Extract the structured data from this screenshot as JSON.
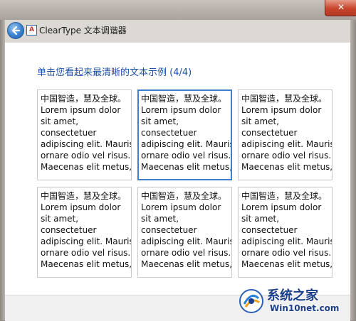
{
  "window": {
    "title": "ClearType 文本调谐器",
    "close_glyph": "✕"
  },
  "page": {
    "heading": "单击您看起来最清晰的文本示例 (4/4)"
  },
  "samples": [
    {
      "lines": [
        "中国智造，慧及全球。",
        "Lorem ipsum dolor",
        "sit amet,",
        "consectetuer",
        "adipiscing elit. Mauris",
        "ornare odio vel risus.",
        "Maecenas elit metus,"
      ],
      "selected": false
    },
    {
      "lines": [
        "中国智造，慧及全球。",
        "Lorem ipsum dolor",
        "sit amet,",
        "consectetuer",
        "adipiscing elit. Mauris",
        "ornare odio vel risus.",
        "Maecenas elit metus,"
      ],
      "selected": true
    },
    {
      "lines": [
        "中国智造，慧及全球。",
        "Lorem ipsum dolor",
        "sit amet,",
        "consectetuer",
        "adipiscing elit. Mauris",
        "ornare odio vel risus.",
        "Maecenas elit metus,"
      ],
      "selected": false
    },
    {
      "lines": [
        "中国智造，慧及全球。",
        "Lorem ipsum dolor",
        "sit amet,",
        "consectetuer",
        "adipiscing elit. Mauris",
        "ornare odio vel risus.",
        "Maecenas elit metus,"
      ],
      "selected": false
    },
    {
      "lines": [
        "中国智造，慧及全球。",
        "Lorem ipsum dolor",
        "sit amet,",
        "consectetuer",
        "adipiscing elit. Mauris",
        "ornare odio vel risus.",
        "Maecenas elit metus,"
      ],
      "selected": false
    },
    {
      "lines": [
        "中国智造，慧及全球。",
        "Lorem ipsum dolor",
        "sit amet,",
        "consectetuer",
        "adipiscing elit. Mauris",
        "ornare odio vel risus.",
        "Maecenas elit metus,"
      ],
      "selected": false
    }
  ],
  "watermark": {
    "name_cn": "系统之家",
    "site": "Win10net.com"
  },
  "icons": {
    "back": "back-arrow-icon",
    "app": "cleartype-app-icon"
  },
  "colors": {
    "accent": "#3c7fd0",
    "heading": "#1e4fa8"
  }
}
